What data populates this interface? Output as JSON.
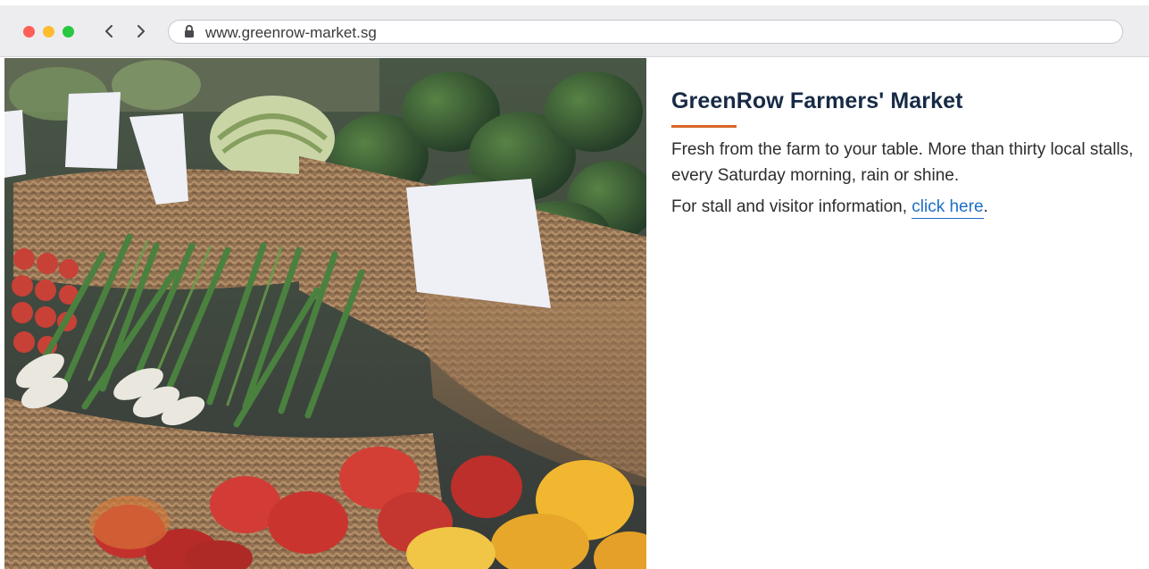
{
  "browser": {
    "url": "www.greenrow-market.sg",
    "window_controls": [
      "close",
      "minimize",
      "zoom"
    ],
    "nav_icons": [
      "chevron-left-icon",
      "chevron-right-icon"
    ],
    "lock_icon": "lock-icon"
  },
  "hero": {
    "image_subject": "farmers-market-vegetable-baskets"
  },
  "page": {
    "title": "GreenRow Farmers' Market",
    "lead": "Fresh from the farm to your table. More than thirty local stalls, every Saturday morning, rain or shine.",
    "info_prefix": "For stall and visitor information, ",
    "link_text": "click here",
    "info_suffix": "."
  },
  "colors": {
    "title": "#172a46",
    "accent_rule": "#d9652a",
    "link": "#1d6ec6",
    "body_text": "#2d2d2d"
  }
}
